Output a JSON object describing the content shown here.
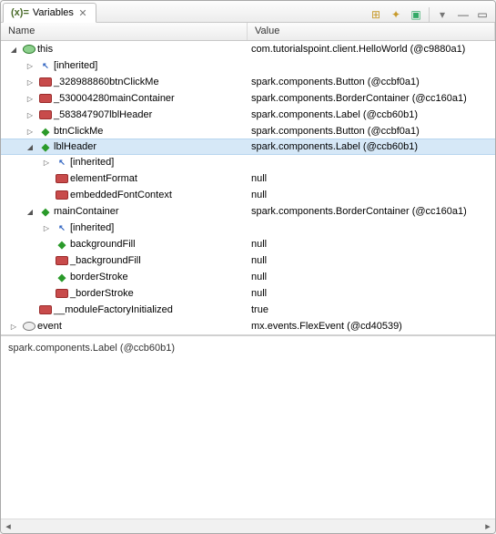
{
  "tab": {
    "title": "Variables",
    "glyph": "(x)="
  },
  "columns": {
    "name": "Name",
    "value": "Value"
  },
  "icons": {
    "toggle_logical": "⊞",
    "add_watch": "✦",
    "collapse_all": "▣",
    "view_menu": "▾",
    "minimize": "—",
    "maximize": "▭",
    "close": "✕",
    "expand_open": "◢",
    "expand_closed": "▷",
    "diamond": "◆",
    "inherit": "↖"
  },
  "tree": [
    {
      "d": 0,
      "exp": "open",
      "icon": "this",
      "name": "this",
      "value": "com.tutorialspoint.client.HelloWorld (@c9880a1)"
    },
    {
      "d": 1,
      "exp": "closed",
      "icon": "inherit",
      "name": "[inherited]",
      "value": ""
    },
    {
      "d": 1,
      "exp": "closed",
      "icon": "pkg",
      "name": "_328988860btnClickMe",
      "value": "spark.components.Button (@ccbf0a1)"
    },
    {
      "d": 1,
      "exp": "closed",
      "icon": "pkg",
      "name": "_530004280mainContainer",
      "value": "spark.components.BorderContainer (@cc160a1)"
    },
    {
      "d": 1,
      "exp": "closed",
      "icon": "pkg",
      "name": "_583847907lblHeader",
      "value": "spark.components.Label (@ccb60b1)"
    },
    {
      "d": 1,
      "exp": "closed",
      "icon": "diamond",
      "name": "btnClickMe",
      "value": "spark.components.Button (@ccbf0a1)"
    },
    {
      "d": 1,
      "exp": "open",
      "icon": "diamond",
      "name": "lblHeader",
      "value": "spark.components.Label (@ccb60b1)",
      "selected": true
    },
    {
      "d": 2,
      "exp": "closed",
      "icon": "inherit",
      "name": "[inherited]",
      "value": ""
    },
    {
      "d": 2,
      "exp": "none",
      "icon": "pkg",
      "name": "elementFormat",
      "value": "null"
    },
    {
      "d": 2,
      "exp": "none",
      "icon": "pkg",
      "name": "embeddedFontContext",
      "value": "null"
    },
    {
      "d": 1,
      "exp": "open",
      "icon": "diamond",
      "name": "mainContainer",
      "value": "spark.components.BorderContainer (@cc160a1)"
    },
    {
      "d": 2,
      "exp": "closed",
      "icon": "inherit",
      "name": "[inherited]",
      "value": ""
    },
    {
      "d": 2,
      "exp": "none",
      "icon": "diamond",
      "name": "backgroundFill",
      "value": "null"
    },
    {
      "d": 2,
      "exp": "none",
      "icon": "pkg",
      "name": "_backgroundFill",
      "value": "null"
    },
    {
      "d": 2,
      "exp": "none",
      "icon": "diamond",
      "name": "borderStroke",
      "value": "null"
    },
    {
      "d": 2,
      "exp": "none",
      "icon": "pkg",
      "name": "_borderStroke",
      "value": "null"
    },
    {
      "d": 1,
      "exp": "none",
      "icon": "pkg",
      "name": "__moduleFactoryInitialized",
      "value": "true"
    },
    {
      "d": 0,
      "exp": "closed",
      "icon": "local",
      "name": "event",
      "value": "mx.events.FlexEvent (@cd40539)"
    }
  ],
  "detail": "spark.components.Label (@ccb60b1)"
}
